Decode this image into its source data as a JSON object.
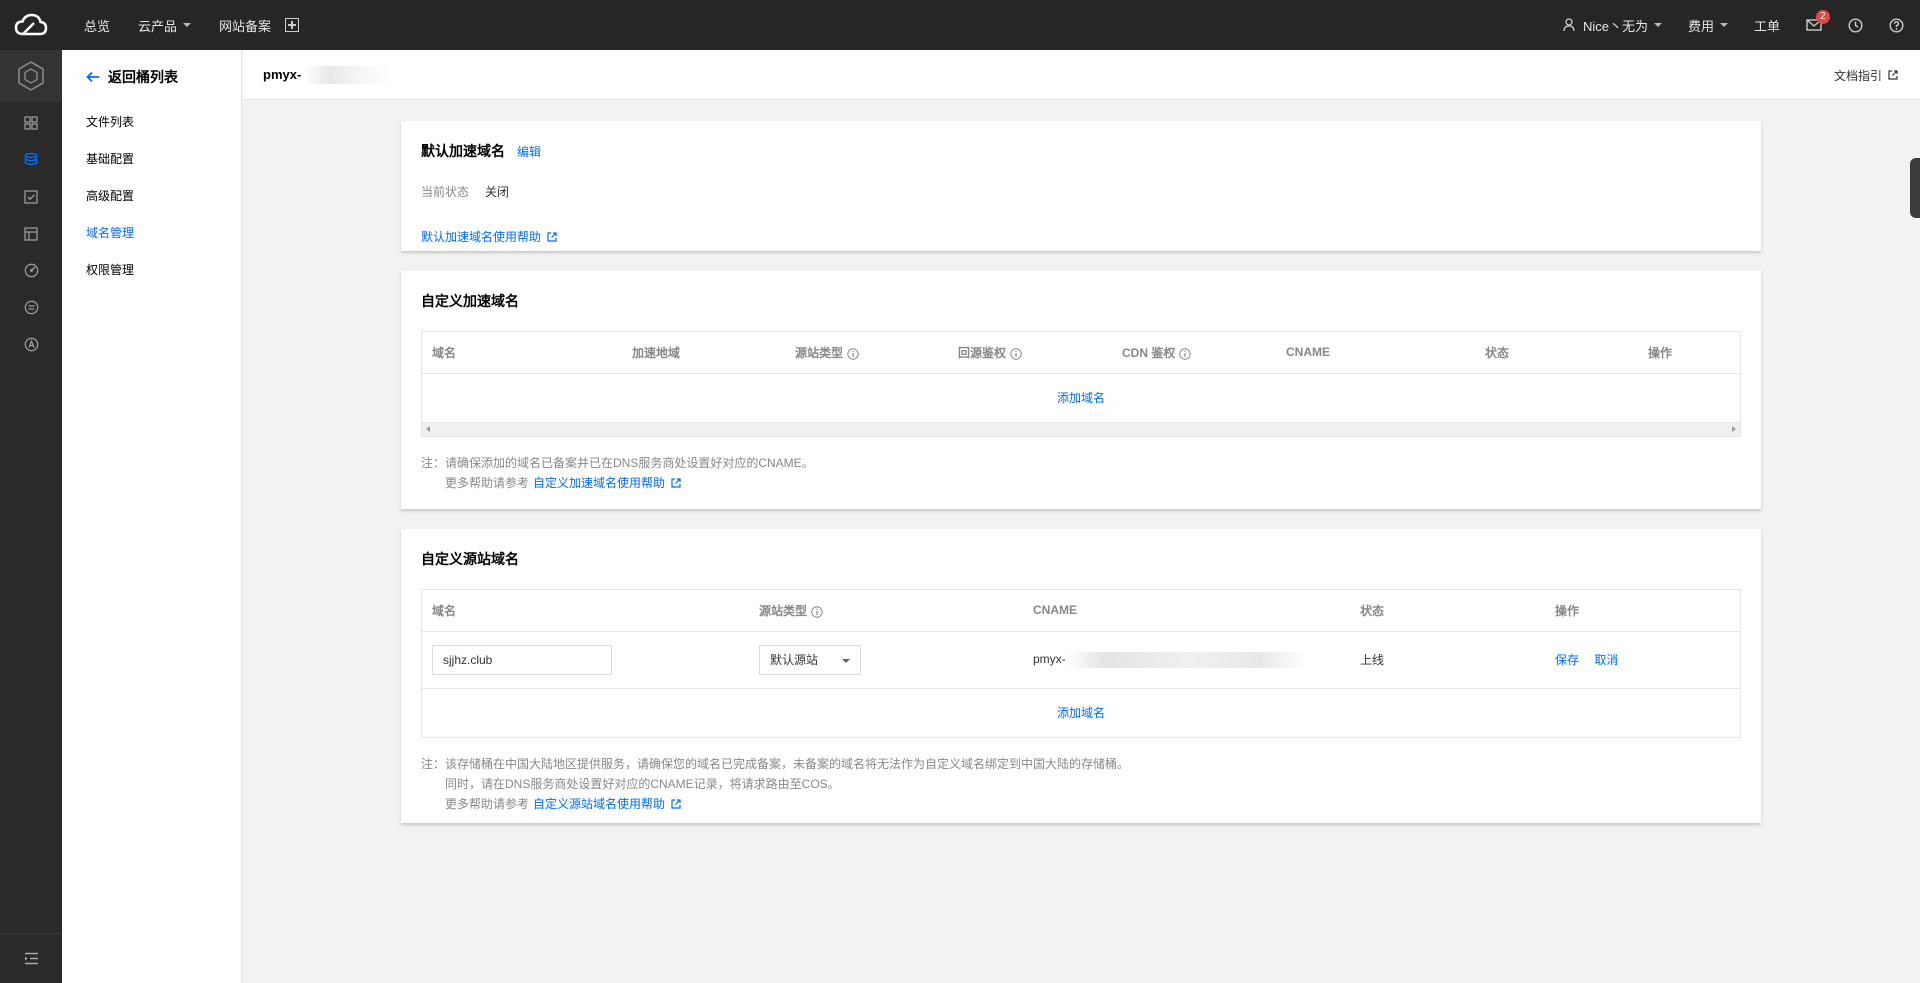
{
  "topbar": {
    "nav": [
      "总览",
      "云产品",
      "网站备案"
    ],
    "user": "Nice丶无为",
    "billing": "费用",
    "ticket": "工单",
    "mail_badge": "2"
  },
  "sidenav": {
    "back": "返回桶列表",
    "items": [
      "文件列表",
      "基础配置",
      "高级配置",
      "域名管理",
      "权限管理"
    ]
  },
  "header": {
    "bucket_name": "pmyx-",
    "doc_guide": "文档指引"
  },
  "default_domain": {
    "title": "默认加速域名",
    "edit": "编辑",
    "status_label": "当前状态",
    "status_value": "关闭",
    "help": "默认加速域名使用帮助"
  },
  "custom_cdn": {
    "title": "自定义加速域名",
    "columns": [
      "域名",
      "加速地域",
      "源站类型",
      "回源鉴权",
      "CDN 鉴权",
      "CNAME",
      "状态",
      "操作"
    ],
    "add": "添加域名",
    "note_line1": "注：请确保添加的域名已备案并已在DNS服务商处设置好对应的CNAME。",
    "note_line2": "更多帮助请参考",
    "note_link": "自定义加速域名使用帮助"
  },
  "custom_origin": {
    "title": "自定义源站域名",
    "columns": [
      "域名",
      "源站类型",
      "CNAME",
      "状态",
      "操作"
    ],
    "row": {
      "domain": "sjjhz.club",
      "origin_type": "默认源站",
      "cname": "pmyx-",
      "cname_tail": "",
      "status": "上线",
      "save": "保存",
      "cancel": "取消"
    },
    "add": "添加域名",
    "note_line1": "注：该存储桶在中国大陆地区提供服务，请确保您的域名已完成备案，未备案的域名将无法作为自定义域名绑定到中国大陆的存储桶。",
    "note_line2": "同时，请在DNS服务商处设置好对应的CNAME记录，将请求路由至COS。",
    "note_line3": "更多帮助请参考",
    "note_link": "自定义源站域名使用帮助"
  }
}
